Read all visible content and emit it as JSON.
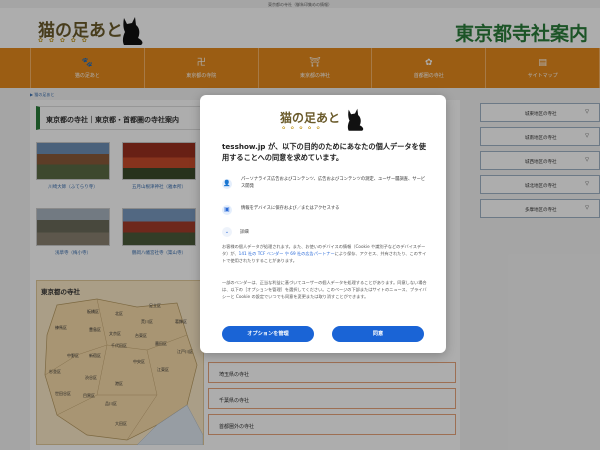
{
  "top_line": "東京都の寺社（御朱印集めの情報）",
  "header": {
    "logo_text": "猫の足あと",
    "paw_marks": "✿ ✿ ✿ ✿ ✿",
    "site_title": "東京都寺社案内"
  },
  "nav": [
    {
      "icon": "🐾",
      "label": "猫の足あと"
    },
    {
      "icon": "卍",
      "label": "東京都の寺院"
    },
    {
      "icon": "⛩",
      "label": "東京都の神社"
    },
    {
      "icon": "✿",
      "label": "首都圏の寺社"
    },
    {
      "icon": "▤",
      "label": "サイトマップ"
    }
  ],
  "breadcrumb": "猫の足あと",
  "main": {
    "heading": "東京都の寺社｜東京都・首都圏の寺社案内",
    "thumbs": [
      {
        "caption": "川崎大師（ふてらり寺）"
      },
      {
        "caption": "五月山根津神社（雅本所）"
      },
      {
        "caption": "浅草寺（梅小寺）"
      },
      {
        "caption": "鶴岡八幡宮社寺（築山寺）"
      }
    ],
    "map_title": "東京都の寺社",
    "map_labels": [
      "千代田区",
      "中央区",
      "港区",
      "新宿区",
      "文京区",
      "台東区",
      "墨田区",
      "江東区",
      "品川区",
      "目黒区",
      "大田区",
      "世田谷区",
      "渋谷区",
      "中野区",
      "杉並区",
      "豊島区",
      "北区",
      "荒川区",
      "板橋区",
      "練馬区",
      "足立区",
      "葛飾区",
      "江戸川区"
    ],
    "regions": [
      "埼玉県の寺社",
      "千葉県の寺社",
      "首都圏外の寺社"
    ]
  },
  "sidebar": [
    "城東地区の寺社",
    "城南地区の寺社",
    "城西地区の寺社",
    "城北地区の寺社",
    "多摩地区の寺社"
  ],
  "modal": {
    "logo_text": "猫の足あと",
    "paw_marks": "✿ ✿ ✿ ✿ ✿",
    "title": "tesshow.jp が、以下の目的のためにあなたの個人データを使用することへの同意を求めています。",
    "purposes": [
      {
        "icon": "👤",
        "text": "パーソナライズ広告およびコンテンツ、広告およびコンテンツの測定、ユーザー層調査、サービス開発"
      },
      {
        "icon": "▣",
        "text": "情報をデバイスに保存および／またはアクセスする"
      }
    ],
    "detail_label": "詳細",
    "para1_a": "お客様の個人データが処理されます。また、お使いのデバイスの情報（Cookie や識別子などのデバイスデータ）が、",
    "para1_link": "141 社の TCF ベンダー や 69 社の広告パートナー",
    "para1_b": "により保存、アクセス、共有されたり、このサイトで使用されたりすることがあります。",
    "para2": "一部のベンダーは、正当な利益に基づいてユーザーの個人データを処理することがあります。同意しない場合は、以下の［オプションを管理］を選択してください。このページの下部またはサイトのニュース、プライバシーと Cookie の設定でいつでも同意を変更または取り消すことができます。",
    "manage_button": "オプションを管理",
    "consent_button": "同意"
  }
}
